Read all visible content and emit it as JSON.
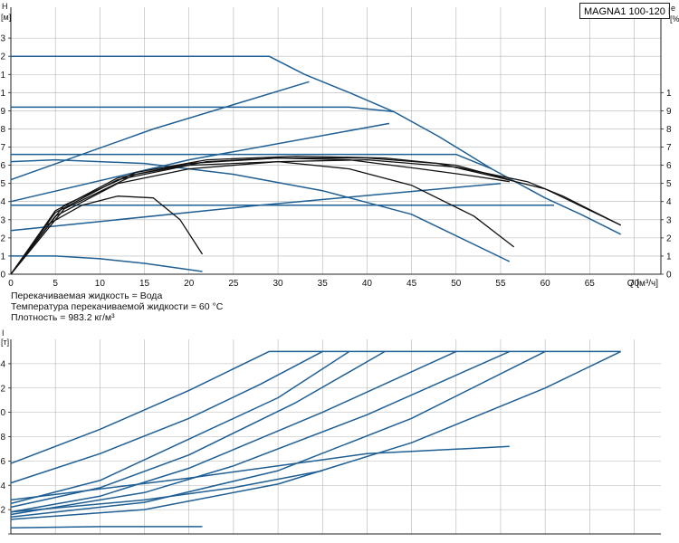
{
  "header": {
    "model": "MAGNA1 100-120 F"
  },
  "fluid_info": {
    "line1": "Перекачиваемая жидкость = Вода",
    "line2": "Температура перекачиваемой жидкости = 60 °C",
    "line3": "Плотность = 983.2 кг/м³"
  },
  "corner_labels": {
    "top_left_symbol": "H",
    "top_left_unit": "[м]",
    "top_right_symbol": "e",
    "top_right_unit": "[%",
    "bottom_left_symbol": "I",
    "bottom_left_unit": "[т]"
  },
  "colors": {
    "pump_curve": "#1f5f94",
    "efficiency_curve": "#111111",
    "grid": "#b5b5b5"
  },
  "chart_data": [
    {
      "type": "line",
      "title": "",
      "xlabel": "Q [м³/ч]",
      "ylabel": "H [м]",
      "xlim": [
        0,
        73
      ],
      "ylim": [
        0,
        14.7
      ],
      "x_ticks": [
        0,
        5,
        10,
        15,
        20,
        25,
        30,
        35,
        40,
        45,
        50,
        55,
        60,
        65,
        70
      ],
      "y_ticks": [
        0,
        1,
        2,
        3,
        4,
        5,
        6,
        7,
        8,
        9,
        10,
        11,
        12,
        13
      ],
      "y_tick_labels": [
        "0",
        "1",
        "2",
        "3",
        "4",
        "5",
        "6",
        "7",
        "8",
        "9",
        "1",
        "1",
        "2",
        "3"
      ],
      "right_tick_labels": [
        "0",
        "1",
        "2",
        "3",
        "4",
        "5",
        "6",
        "7",
        "8",
        "9",
        "1"
      ],
      "grid": true,
      "series": [
        {
          "color": "#1f5f94",
          "points": [
            [
              0,
              12
            ],
            [
              29,
              12
            ],
            [
              33,
              11
            ],
            [
              38,
              10
            ],
            [
              43,
              8.95
            ],
            [
              48,
              7.6
            ],
            [
              54,
              5.8
            ],
            [
              60,
              4.2
            ],
            [
              64,
              3.3
            ],
            [
              68.5,
              2.2
            ]
          ]
        },
        {
          "color": "#1f5f94",
          "points": [
            [
              0,
              9.2
            ],
            [
              29,
              9.2
            ],
            [
              38,
              9.2
            ],
            [
              43,
              8.95
            ]
          ]
        },
        {
          "color": "#1f5f94",
          "points": [
            [
              0,
              6.6
            ],
            [
              40,
              6.6
            ],
            [
              50,
              6.6
            ],
            [
              54,
              5.8
            ]
          ]
        },
        {
          "color": "#1f5f94",
          "points": [
            [
              0,
              3.8
            ],
            [
              40,
              3.8
            ],
            [
              61,
              3.8
            ]
          ]
        },
        {
          "color": "#1f5f94",
          "points": [
            [
              0,
              5.2
            ],
            [
              16,
              8.0
            ],
            [
              33.5,
              10.6
            ]
          ]
        },
        {
          "color": "#1f5f94",
          "points": [
            [
              0,
              4.0
            ],
            [
              20,
              6.3
            ],
            [
              42.5,
              8.3
            ]
          ]
        },
        {
          "color": "#1f5f94",
          "points": [
            [
              0,
              2.4
            ],
            [
              28,
              3.8
            ],
            [
              55,
              5.0
            ]
          ]
        },
        {
          "color": "#1f5f94",
          "points": [
            [
              0,
              6.2
            ],
            [
              5,
              6.3
            ],
            [
              15,
              6.1
            ],
            [
              25,
              5.5
            ],
            [
              35,
              4.6
            ],
            [
              45,
              3.3
            ],
            [
              56,
              0.7
            ]
          ]
        },
        {
          "color": "#1f5f94",
          "points": [
            [
              0,
              1.0
            ],
            [
              5,
              1.0
            ],
            [
              10,
              0.85
            ],
            [
              15,
              0.6
            ],
            [
              21.5,
              0.15
            ]
          ]
        },
        {
          "color": "#111111",
          "points": [
            [
              0,
              0
            ],
            [
              4,
              2.7
            ],
            [
              8,
              3.8
            ],
            [
              12,
              4.3
            ],
            [
              16,
              4.2
            ],
            [
              19,
              3.0
            ],
            [
              21.5,
              1.1
            ]
          ]
        },
        {
          "color": "#111111",
          "points": [
            [
              0,
              0
            ],
            [
              5,
              3.4
            ],
            [
              12,
              5.2
            ],
            [
              20,
              6.0
            ],
            [
              30,
              6.2
            ],
            [
              38,
              5.8
            ],
            [
              45,
              4.9
            ],
            [
              52,
              3.2
            ],
            [
              56.5,
              1.5
            ]
          ]
        },
        {
          "color": "#111111",
          "points": [
            [
              0,
              0
            ],
            [
              5,
              3.2
            ],
            [
              12,
              5.0
            ],
            [
              20,
              5.8
            ],
            [
              30,
              6.2
            ],
            [
              40,
              6.3
            ],
            [
              50,
              5.9
            ],
            [
              58,
              5.1
            ],
            [
              62,
              4.3
            ],
            [
              68.5,
              2.7
            ]
          ]
        },
        {
          "color": "#111111",
          "points": [
            [
              0,
              0
            ],
            [
              5,
              3.5
            ],
            [
              12,
              5.3
            ],
            [
              20,
              6.1
            ],
            [
              30,
              6.4
            ],
            [
              40,
              6.4
            ],
            [
              48,
              6.1
            ],
            [
              55,
              5.3
            ],
            [
              60,
              4.7
            ],
            [
              68.5,
              2.7
            ]
          ]
        },
        {
          "color": "#111111",
          "points": [
            [
              0,
              0
            ],
            [
              6,
              3.6
            ],
            [
              14,
              5.5
            ],
            [
              22,
              6.2
            ],
            [
              30,
              6.4
            ],
            [
              38,
              6.3
            ],
            [
              46,
              5.8
            ],
            [
              52,
              5.4
            ],
            [
              56,
              5.1
            ]
          ]
        },
        {
          "color": "#111111",
          "points": [
            [
              0,
              0
            ],
            [
              6,
              3.8
            ],
            [
              14,
              5.6
            ],
            [
              22,
              6.3
            ],
            [
              32,
              6.5
            ],
            [
              42,
              6.4
            ],
            [
              50,
              6.0
            ],
            [
              56,
              5.2
            ]
          ]
        }
      ]
    },
    {
      "type": "line",
      "title": "",
      "xlabel": "",
      "ylabel": "I [т]",
      "xlim": [
        0,
        73
      ],
      "ylim": [
        0,
        16
      ],
      "x_ticks": [
        0,
        5,
        10,
        15,
        20,
        25,
        30,
        35,
        40,
        45,
        50,
        55,
        60,
        65,
        70
      ],
      "y_ticks": [
        0,
        2,
        4,
        6,
        8,
        10,
        12,
        14
      ],
      "y_tick_labels": [
        "",
        "2",
        "4",
        "6",
        "8",
        "0",
        "2",
        "4"
      ],
      "grid": true,
      "series": [
        {
          "color": "#1f5f94",
          "points": [
            [
              0,
              5.8
            ],
            [
              10,
              8.6
            ],
            [
              20,
              11.8
            ],
            [
              29,
              15.0
            ],
            [
              68.5,
              15.0
            ]
          ]
        },
        {
          "color": "#1f5f94",
          "points": [
            [
              0,
              4.2
            ],
            [
              10,
              6.6
            ],
            [
              20,
              9.5
            ],
            [
              28,
              12.3
            ],
            [
              35,
              15.0
            ]
          ]
        },
        {
          "color": "#1f5f94",
          "points": [
            [
              0,
              2.5
            ],
            [
              10,
              4.4
            ],
            [
              20,
              7.8
            ],
            [
              30,
              11.2
            ],
            [
              38,
              15.0
            ]
          ]
        },
        {
          "color": "#1f5f94",
          "points": [
            [
              0,
              2.2
            ],
            [
              10,
              3.8
            ],
            [
              20,
              6.5
            ],
            [
              32,
              10.8
            ],
            [
              42,
              15.0
            ]
          ]
        },
        {
          "color": "#1f5f94",
          "points": [
            [
              0,
              1.8
            ],
            [
              10,
              3.1
            ],
            [
              20,
              5.4
            ],
            [
              35,
              10.0
            ],
            [
              50,
              15.0
            ]
          ]
        },
        {
          "color": "#1f5f94",
          "points": [
            [
              0,
              1.6
            ],
            [
              15,
              3.4
            ],
            [
              25,
              5.6
            ],
            [
              40,
              9.8
            ],
            [
              56,
              15.0
            ]
          ]
        },
        {
          "color": "#1f5f94",
          "points": [
            [
              0,
              1.4
            ],
            [
              15,
              2.6
            ],
            [
              30,
              5.2
            ],
            [
              45,
              9.5
            ],
            [
              60,
              15.0
            ]
          ]
        },
        {
          "color": "#1f5f94",
          "points": [
            [
              0,
              1.2
            ],
            [
              15,
              2.0
            ],
            [
              30,
              4.1
            ],
            [
              45,
              7.5
            ],
            [
              60,
              12.0
            ],
            [
              68.5,
              15.0
            ]
          ]
        },
        {
          "color": "#1f5f94",
          "points": [
            [
              0,
              0.5
            ],
            [
              10,
              0.6
            ],
            [
              21.5,
              0.6
            ]
          ]
        },
        {
          "color": "#1f5f94",
          "points": [
            [
              0,
              2.8
            ],
            [
              20,
              4.6
            ],
            [
              30,
              5.6
            ],
            [
              40,
              6.6
            ],
            [
              56,
              7.2
            ]
          ]
        },
        {
          "color": "#1f5f94",
          "points": [
            [
              0,
              1.8
            ],
            [
              15,
              2.8
            ],
            [
              25,
              3.8
            ],
            [
              35,
              5.2
            ]
          ]
        }
      ]
    }
  ]
}
